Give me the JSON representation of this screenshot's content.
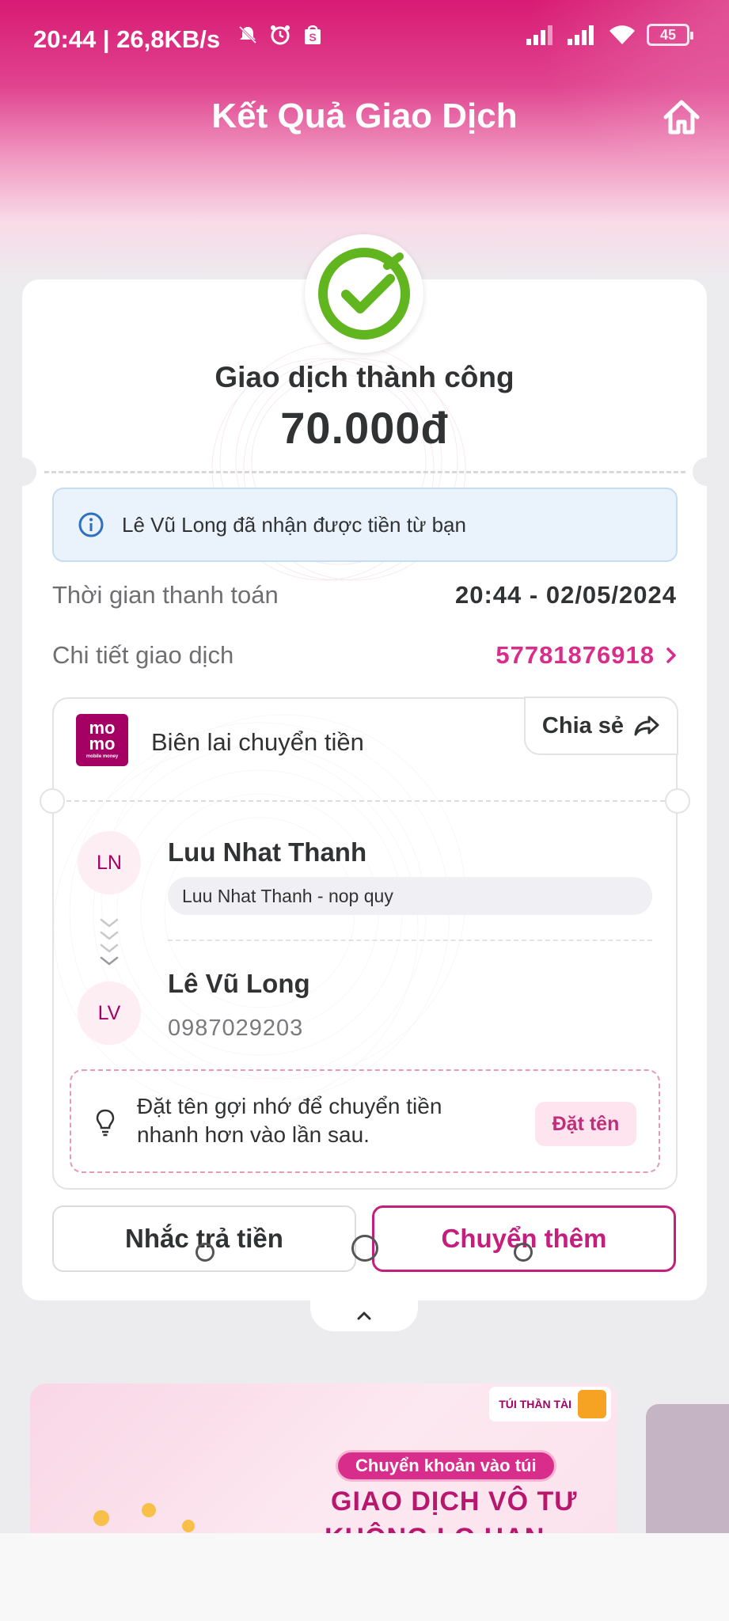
{
  "status_bar": {
    "time_speed": "20:44 | 26,8KB/s",
    "battery": "45"
  },
  "header": {
    "title": "Kết Quả Giao Dịch"
  },
  "result": {
    "status": "Giao dịch thành công",
    "amount": "70.000đ",
    "notice": "Lê Vũ Long đã nhận được tiền từ bạn"
  },
  "details": {
    "time_label": "Thời gian thanh toán",
    "time_value": "20:44 - 02/05/2024",
    "txn_label": "Chi tiết giao dịch",
    "txn_value": "57781876918"
  },
  "receipt": {
    "logo_line1": "mo",
    "logo_line2": "mo",
    "logo_tagline": "mobile money",
    "title": "Biên lai chuyển tiền",
    "share_label": "Chia sẻ",
    "sender": {
      "initials": "LN",
      "name": "Luu Nhat Thanh",
      "message": "Luu Nhat Thanh - nop quy"
    },
    "receiver": {
      "initials": "LV",
      "name": "Lê Vũ Long",
      "phone": "0987029203"
    },
    "tip_text": "Đặt tên gợi nhớ để chuyển tiền nhanh hơn vào lần sau.",
    "name_button": "Đặt tên"
  },
  "actions": {
    "remind": "Nhắc trả tiền",
    "send_more": "Chuyển thêm"
  },
  "banner": {
    "brand": "TÚI THẦN TÀI",
    "pill": "Chuyển khoản vào túi",
    "title_line1": "GIAO DỊCH VÔ TƯ",
    "title_line2": "KHÔNG LO HẠN MỨC"
  },
  "colors": {
    "brand": "#a50064",
    "accent": "#d82d8b",
    "success": "#61b51e"
  }
}
